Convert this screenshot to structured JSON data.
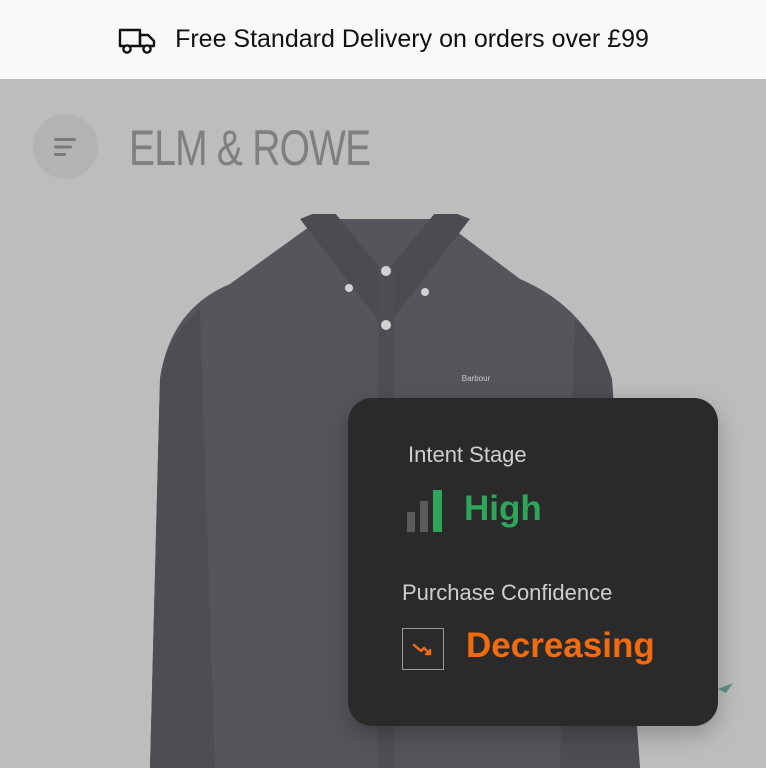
{
  "announcement": {
    "icon": "truck-icon",
    "text": "Free Standard Delivery on orders over £99"
  },
  "header": {
    "menu_icon": "menu-icon",
    "logo": "ELM & ROWE"
  },
  "hero": {
    "image": "man-in-navy-button-down-shirt",
    "shirt_brand": "Barbour"
  },
  "insight_card": {
    "intent_label": "Intent Stage",
    "intent_icon": "signal-bars-icon",
    "intent_value": "High",
    "intent_color": "#2ea55a",
    "confidence_label": "Purchase Confidence",
    "confidence_icon": "trend-down-icon",
    "confidence_value": "Decreasing",
    "confidence_color": "#f26b10"
  }
}
